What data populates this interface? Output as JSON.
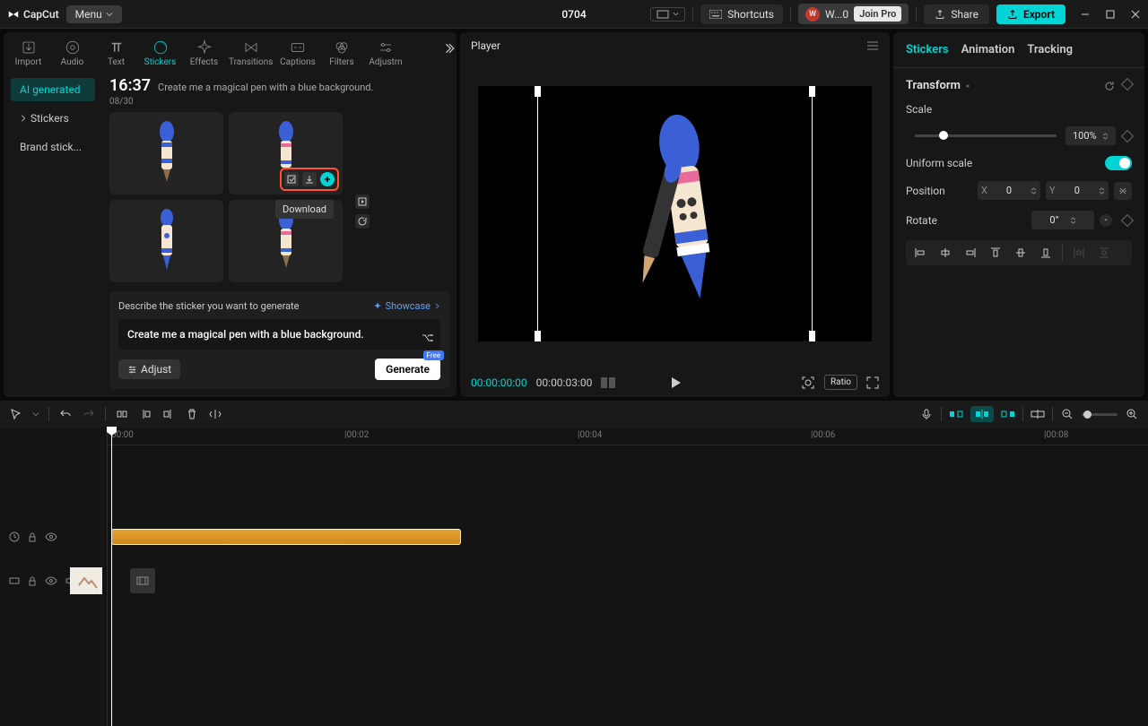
{
  "topbar": {
    "logo": "CapCut",
    "menu": "Menu",
    "title": "0704",
    "shortcuts": "Shortcuts",
    "user_short": "W...0",
    "user_letter": "W",
    "join_pro": "Join Pro",
    "share": "Share",
    "export": "Export"
  },
  "tabs": [
    "Import",
    "Audio",
    "Text",
    "Stickers",
    "Effects",
    "Transitions",
    "Captions",
    "Filters",
    "Adjustm"
  ],
  "active_tab": "Stickers",
  "sidebar": {
    "ai_generated": "AI generated",
    "stickers": "Stickers",
    "brand": "Brand stick..."
  },
  "gen": {
    "time": "16:37",
    "prompt_title": "Create me a magical pen with a blue background.",
    "count": "08/30",
    "tooltip": "Download",
    "describe": "Describe the sticker you want to generate",
    "showcase": "Showcase",
    "prompt_value": "Create me a magical pen with a blue background.",
    "adjust": "Adjust",
    "generate": "Generate",
    "free": "Free"
  },
  "player": {
    "title": "Player",
    "time_current": "00:00:00:00",
    "time_duration": "00:00:03:00",
    "ratio": "Ratio"
  },
  "right": {
    "tabs": [
      "Stickers",
      "Animation",
      "Tracking"
    ],
    "transform": "Transform",
    "scale": "Scale",
    "scale_val": "100%",
    "uniform": "Uniform scale",
    "position": "Position",
    "pos_x": "0",
    "pos_y": "0",
    "rotate": "Rotate",
    "rotate_val": "0°"
  },
  "timeline": {
    "ticks": [
      "00:00",
      "00:02",
      "00:04",
      "00:06",
      "00:08"
    ]
  }
}
